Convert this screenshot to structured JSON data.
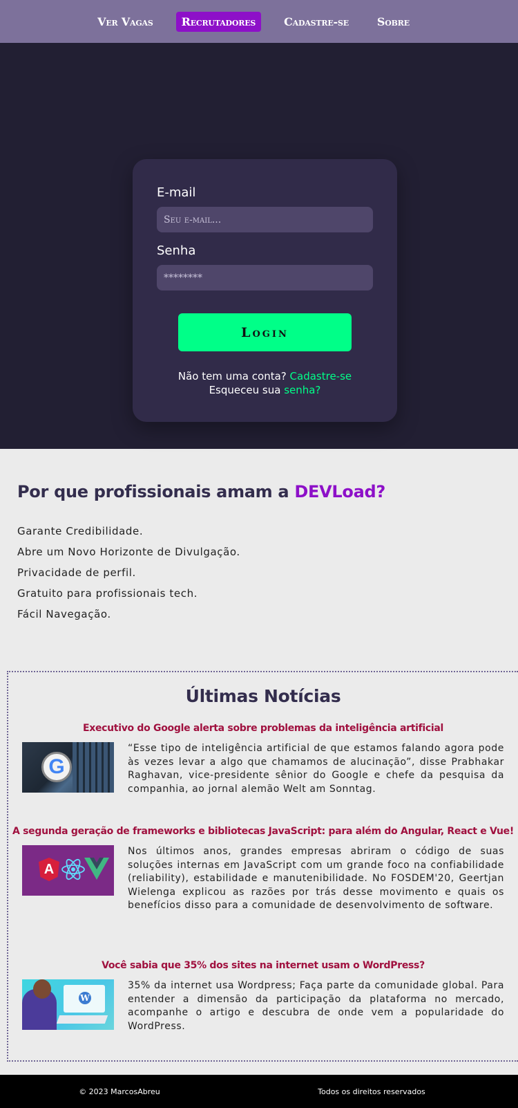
{
  "nav": {
    "items": [
      {
        "label": "Ver Vagas"
      },
      {
        "label": "Recrutadores"
      },
      {
        "label": "Cadastre-se"
      },
      {
        "label": "Sobre"
      }
    ]
  },
  "login": {
    "email_label": "E-mail",
    "email_placeholder": "Seu e-mail...",
    "password_label": "Senha",
    "password_placeholder": "********",
    "button_label": "Login",
    "no_account_text": "Não tem uma conta?",
    "signup_link": "Cadastre-se",
    "forgot_text": "Esqueceu sua",
    "forgot_link": "senha?"
  },
  "why": {
    "title_prefix": "Por que profissionais amam a ",
    "title_brand": "DEVLoad?",
    "items": [
      "Garante Credibilidade.",
      "Abre um Novo Horizonte de Divulgação.",
      "Privacidade de perfil.",
      "Gratuito para profissionais tech.",
      "Fácil Navegação."
    ]
  },
  "news": {
    "title": "Últimas Notícias",
    "articles": [
      {
        "title": "Executivo do Google alerta sobre problemas da inteligência artificial",
        "text": "“Esse tipo de inteligência artificial de que estamos falando agora pode às vezes levar a algo que chamamos de alucinação”, disse Prabhakar Raghavan, vice-presidente sênior do Google e chefe da pesquisa da companhia, ao jornal alemão Welt am Sonntag."
      },
      {
        "title": "A segunda geração de frameworks e bibliotecas JavaScript: para além do Angular, React e Vue!",
        "text": "Nos últimos anos, grandes empresas abriram o código de suas soluções internas em JavaScript com um grande foco na confiabilidade (reliability), estabilidade e manutenibilidade. No FOSDEM'20, Geertjan Wielenga explicou as razões por trás desse movimento e quais os benefícios disso para a comunidade de desenvolvimento de software."
      },
      {
        "title": "Você sabia que 35% dos sites na internet usam o WordPress?",
        "text": "35% da internet usa Wordpress; Faça parte da comunidade global. Para entender a dimensão da participação da plataforma no mercado, acompanhe o artigo e descubra de onde vem a popularidade do WordPress."
      }
    ]
  },
  "footer": {
    "copyright": "© 2023 MarcosAbreu",
    "rights": "Todos os direitos reservados"
  },
  "colors": {
    "nav_bg": "#7d719b",
    "active_nav": "#8d10c8",
    "hero_bg": "#221f33",
    "card_bg": "#312b49",
    "accent_green": "#00ff88",
    "article_title": "#a0113f",
    "heading": "#332d4d"
  },
  "icons": {
    "article_1": "google-logo-image",
    "article_2": "angular-react-vue-image",
    "article_3": "wordpress-illustration-image"
  }
}
